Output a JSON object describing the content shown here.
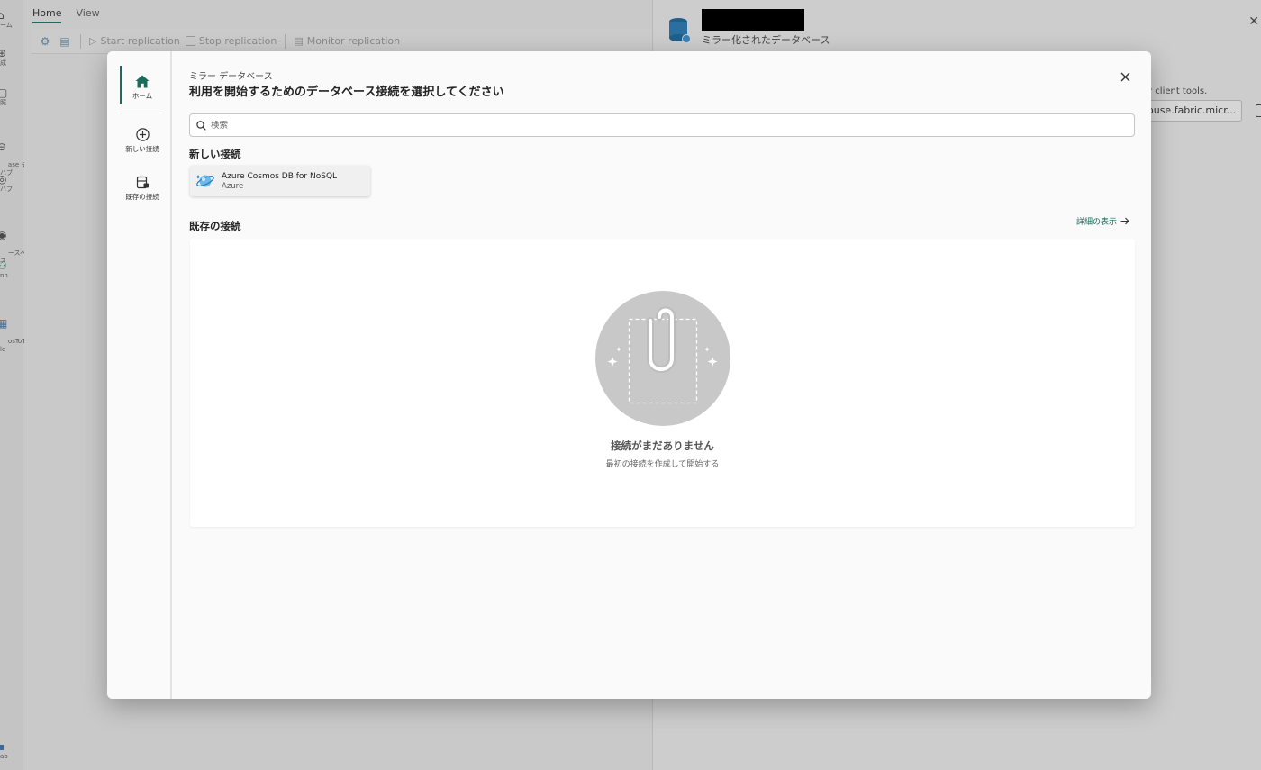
{
  "background": {
    "tabs": [
      "Home",
      "View"
    ],
    "toolbar": {
      "start_replication": "Start replication",
      "stop_replication": "Stop replication",
      "monitor_replication": "Monitor replication"
    },
    "rail": [
      {
        "label": "ーム",
        "icon": "home-icon"
      },
      {
        "label": "成",
        "icon": "create-icon"
      },
      {
        "label": "照",
        "icon": "browse-icon"
      },
      {
        "label": "ase デ\nハブ",
        "icon": "datahub-icon"
      },
      {
        "label": "ハブ",
        "icon": "hub-icon"
      },
      {
        "label": "ースペ\nス",
        "icon": "workspace-icon"
      },
      {
        "label": "nn",
        "icon": "people-icon"
      },
      {
        "label": "osToTa\nle",
        "icon": "item-icon"
      },
      {
        "label": "ab",
        "icon": "db-icon"
      }
    ],
    "pane": {
      "subtitle": "ミラー化されたデータベース",
      "client_tools": "r client tools.",
      "endpoint_value": "ouse.fabric.micr...",
      "close": "✕"
    }
  },
  "modal": {
    "subtitle": "ミラー データベース",
    "title": "利用を開始するためのデータベース接続を選択してください",
    "close_label": "✕",
    "sidebar": {
      "home": "ホーム",
      "new_connection": "新しい接続",
      "existing_connection": "既存の接続"
    },
    "search": {
      "placeholder": "検索"
    },
    "new_connections": {
      "heading": "新しい接続",
      "items": [
        {
          "title": "Azure Cosmos DB for NoSQL",
          "subtitle": "Azure"
        }
      ]
    },
    "existing_connections": {
      "heading": "既存の接続",
      "view_details": "詳細の表示",
      "empty_title": "接続がまだありません",
      "empty_subtitle": "最初の接続を作成して開始する"
    }
  },
  "colors": {
    "accent": "#1d6b5a",
    "overlay": "#c8c8c8",
    "modal_bg": "#fafafa",
    "illustration": "#c8c8c8"
  }
}
